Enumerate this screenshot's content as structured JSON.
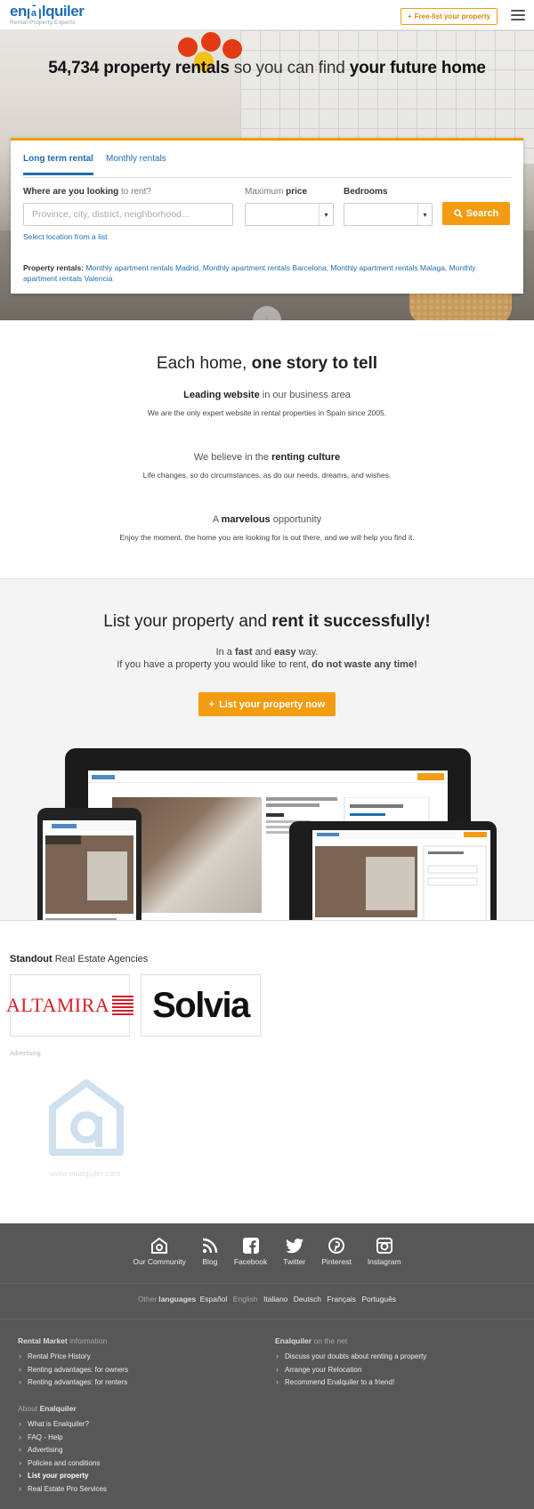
{
  "header": {
    "logo_text": "enalquiler",
    "logo_sub": "Rental Property Experts",
    "free_list_label": "Free-list your property",
    "menu_icon": "hamburger-icon"
  },
  "hero": {
    "count": "54,734",
    "title_part1": "property rentals",
    "title_part2": "so you can find",
    "title_part3": "your future home",
    "tabs": [
      "Long term rental",
      "Monthly rentals"
    ],
    "where_label_bold": "Where are you looking",
    "where_label_rest": "to rent?",
    "where_placeholder": "Province, city, district, neighborhood...",
    "price_label_light": "Maximum",
    "price_label_bold": "price",
    "bedrooms_label": "Bedrooms",
    "search_label": "Search",
    "select_location": "Select location from a list",
    "rentals_label": "Property rentals:",
    "rental_links": [
      "Monthly apartment rentals Madrid,",
      "Monthly apartment rentals Barcelona,",
      "Monthly apartment rentals Malaga,",
      "Monthly apartment rentals Valencia"
    ]
  },
  "story": {
    "title_light": "Each home,",
    "title_bold": "one story to tell",
    "items": [
      {
        "head_bold": "Leading website",
        "head_rest": "in our business area",
        "text": "We are the only expert website in rental properties in Spain since 2005."
      },
      {
        "head_pre": "We believe in the",
        "head_bold": "renting culture",
        "text": "Life changes, so do circumstances, as do our needs, dreams, and wishes."
      },
      {
        "head_pre": "A",
        "head_bold": "marvelous",
        "head_rest": "opportunity",
        "text": "Enjoy the moment, the home you are looking for is out there, and we will help you find it."
      }
    ]
  },
  "list_property": {
    "title_light": "List your property and",
    "title_bold": "rent it successfully!",
    "line1_pre": "In a",
    "line1_b1": "fast",
    "line1_mid": "and",
    "line1_b2": "easy",
    "line1_post": "way.",
    "line2_pre": "If you have a property you would like to rent,",
    "line2_bold": "do not waste any time!",
    "button_label": "List your property now"
  },
  "agencies": {
    "title_bold": "Standout",
    "title_rest": "Real Estate Agencies",
    "logos": [
      "ALTAMIRA",
      "Solvia"
    ],
    "advertising": "Advertising",
    "ad_url": "www.enalquiler.com"
  },
  "footer": {
    "social": [
      {
        "label": "Our Community",
        "icon": "community-icon"
      },
      {
        "label": "Blog",
        "icon": "rss-icon"
      },
      {
        "label": "Facebook",
        "icon": "facebook-icon"
      },
      {
        "label": "Twitter",
        "icon": "twitter-icon"
      },
      {
        "label": "Pinterest",
        "icon": "pinterest-icon"
      },
      {
        "label": "Instagram",
        "icon": "instagram-icon"
      }
    ],
    "languages_pre": "Other",
    "languages_bold": "languages",
    "languages": [
      "Español",
      "English",
      "Italiano",
      "Deutsch",
      "Français",
      "Português"
    ],
    "rental_market_bold": "Rental Market",
    "rental_market_rest": "information",
    "rental_market_links": [
      "Rental Price History",
      "Renting advantages: for owners",
      "Renting advantages: for renters"
    ],
    "on_net_bold": "Enalquiler",
    "on_net_rest": "on the net",
    "on_net_links": [
      "Discuss your doubts about renting a property",
      "Arrange your Relocation",
      "Recommend Enalquiler to a friend!"
    ],
    "about_pre": "About",
    "about_bold": "Enalquiler",
    "about_links": [
      "What is Enalquiler?",
      "FAQ - Help",
      "Advertising",
      "Policies and conditions",
      "List your property",
      "Real Estate Pro Services"
    ]
  },
  "colors": {
    "accent": "#f39c12",
    "brand": "#1f6db3",
    "footer": "#575757"
  }
}
